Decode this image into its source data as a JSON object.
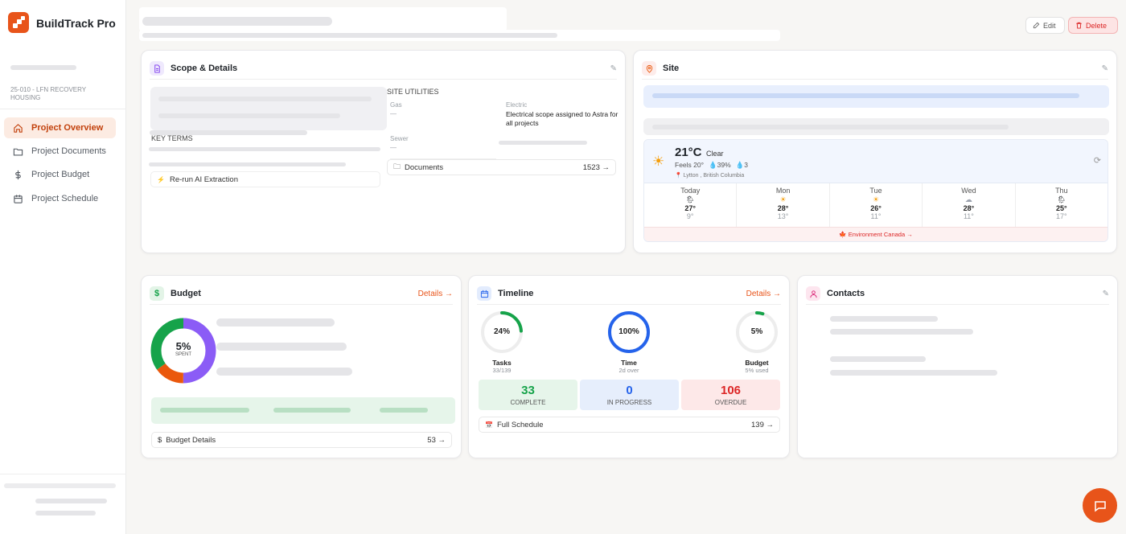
{
  "app": {
    "brand": "BuildTrack Pro",
    "project_code": "25-010 - LFN RECOVERY HOUSING"
  },
  "sidebar": {
    "items": [
      {
        "label": "Project Overview",
        "icon": "home-icon",
        "active": true
      },
      {
        "label": "Project Documents",
        "icon": "folder-icon",
        "active": false
      },
      {
        "label": "Project Budget",
        "icon": "dollar-icon",
        "active": false
      },
      {
        "label": "Project Schedule",
        "icon": "calendar-icon",
        "active": false
      }
    ]
  },
  "header": {
    "edit_label": "Edit",
    "delete_label": "Delete"
  },
  "scope": {
    "title": "Scope & Details",
    "key_terms_label": "KEY TERMS",
    "rerun_label": "Re-run AI Extraction",
    "site_utilities_label": "SITE UTILITIES",
    "gas_label": "Gas",
    "gas_value": "—",
    "electric_label": "Electric",
    "electric_value": "Electrical scope assigned to Astra for all projects",
    "sewer_label": "Sewer",
    "sewer_value": "—",
    "documents_label": "Documents",
    "documents_count": "1523 →"
  },
  "site": {
    "title": "Site",
    "weather": {
      "temp": "21°C",
      "condition": "Clear",
      "feels": "Feels 20°",
      "humidity": "39%",
      "precip": "3",
      "location": "Lytton , British Columbia",
      "days": [
        {
          "name": "Today",
          "icon": "🌦",
          "high": "27°",
          "low": "9°"
        },
        {
          "name": "Mon",
          "icon": "☀",
          "high": "28°",
          "low": "13°"
        },
        {
          "name": "Tue",
          "icon": "☀",
          "high": "26°",
          "low": "11°"
        },
        {
          "name": "Wed",
          "icon": "☁",
          "high": "28°",
          "low": "11°"
        },
        {
          "name": "Thu",
          "icon": "🌦",
          "high": "25°",
          "low": "17°"
        }
      ],
      "source": "Environment Canada →"
    }
  },
  "budget": {
    "title": "Budget",
    "details_link": "Details →",
    "donut_value": "5%",
    "donut_label": "SPENT",
    "donut_segments": [
      {
        "color": "#8b5cf6",
        "fraction": 0.5
      },
      {
        "color": "#ea580c",
        "fraction": 0.15
      },
      {
        "color": "#16a34a",
        "fraction": 0.35
      }
    ],
    "footer_label": "Budget Details",
    "footer_count": "53 →"
  },
  "timeline": {
    "title": "Timeline",
    "details_link": "Details →",
    "rings": [
      {
        "pct": "24%",
        "name": "Tasks",
        "sub": "33/139",
        "fraction": 0.24,
        "color": "#16a34a"
      },
      {
        "pct": "100%",
        "name": "Time",
        "sub": "2d over",
        "fraction": 1.0,
        "color": "#2563eb"
      },
      {
        "pct": "5%",
        "name": "Budget",
        "sub": "5% used",
        "fraction": 0.05,
        "color": "#16a34a"
      }
    ],
    "stats": [
      {
        "value": "33",
        "label": "COMPLETE",
        "color": "#16a34a",
        "bg": "#e6f5ea"
      },
      {
        "value": "0",
        "label": "IN PROGRESS",
        "color": "#2563eb",
        "bg": "#e6eefc"
      },
      {
        "value": "106",
        "label": "OVERDUE",
        "color": "#dc2626",
        "bg": "#fde8e8"
      }
    ],
    "footer_label": "Full Schedule",
    "footer_count": "139 →"
  },
  "contacts": {
    "title": "Contacts"
  }
}
